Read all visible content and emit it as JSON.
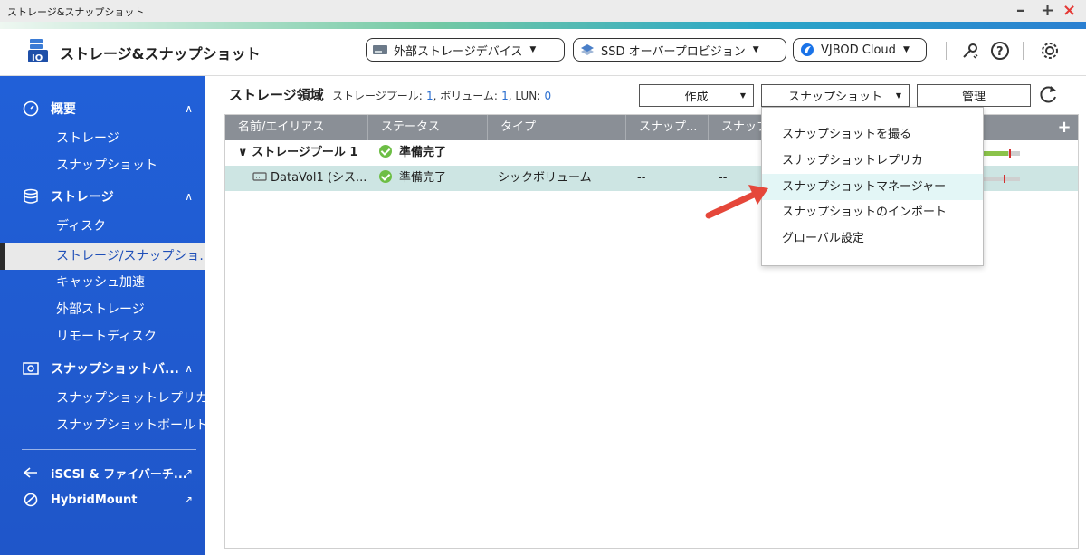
{
  "window": {
    "title": "ストレージ&スナップショット",
    "minimize": "–",
    "maximize": "+",
    "close": "×"
  },
  "header": {
    "app_title": "ストレージ&スナップショット",
    "external_storage_btn": "外部ストレージデバイス",
    "ssd_btn": "SSD オーバープロビジョン",
    "vjbod_btn": "VJBOD Cloud"
  },
  "sidebar": {
    "overview": {
      "label": "概要",
      "items": [
        "ストレージ",
        "スナップショット"
      ]
    },
    "storage": {
      "label": "ストレージ",
      "items": [
        "ディスク",
        "ストレージ/スナップショ...",
        "キャッシュ加速",
        "外部ストレージ",
        "リモートディスク"
      ]
    },
    "snapshot_backup": {
      "label": "スナップショットバ...",
      "items": [
        "スナップショットレプリカ",
        "スナップショットボールト"
      ]
    },
    "iscsi": "iSCSI & ファイバーチ...",
    "hybridmount": "HybridMount"
  },
  "main": {
    "breadcrumb": {
      "title": "ストレージ領域",
      "pool_label": "ストレージプール:",
      "pool_count": "1",
      "volume_label": ", ボリューム:",
      "volume_count": "1",
      "lun_label": ", LUN:",
      "lun_count": "0"
    },
    "toolbar": {
      "create": "作成",
      "snapshot": "スナップショット",
      "manage": "管理"
    },
    "table": {
      "columns": [
        "名前/エイリアス",
        "ステータス",
        "タイプ",
        "スナップ...",
        "スナップ"
      ],
      "rows": [
        {
          "name": "ストレージプール 1",
          "status": "準備完了",
          "type": "",
          "snap1": "",
          "snap2": ""
        },
        {
          "name": "DataVol1 (シス...",
          "status": "準備完了",
          "type": "シックボリューム",
          "snap1": "--",
          "snap2": "--"
        }
      ]
    },
    "snapshot_menu": [
      "スナップショットを撮る",
      "スナップショットレプリカ",
      "スナップショットマネージャー",
      "スナップショットのインポート",
      "グローバル設定"
    ]
  },
  "colors": {
    "sidebar_bg": "#2160d8",
    "header_row_bg": "#8a8f96",
    "selected_row_bg": "#cde5e3",
    "ok_green": "#6dbe45",
    "arrow_red": "#e5473a"
  }
}
